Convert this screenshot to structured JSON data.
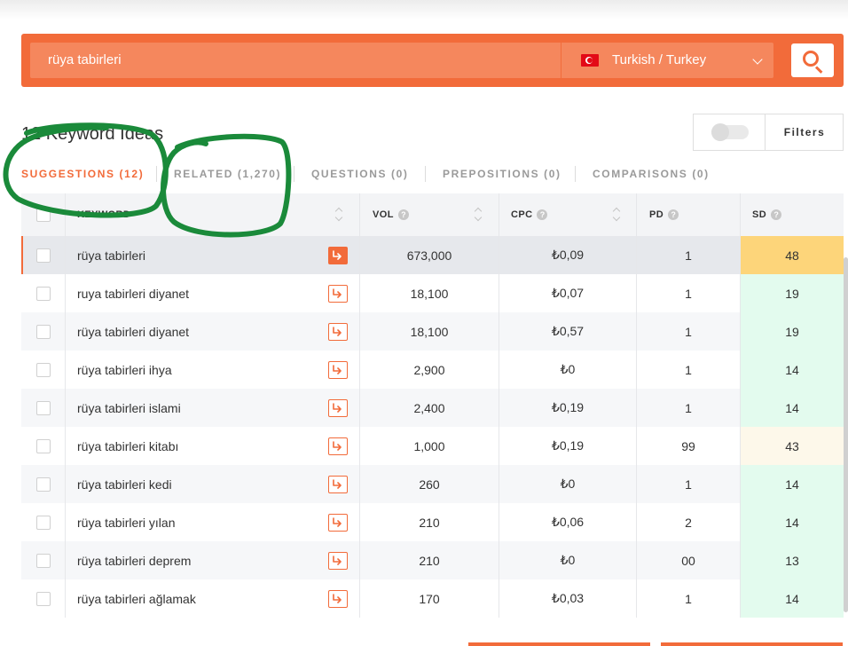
{
  "search": {
    "query": "rüya tabirleri",
    "language": "Turkish / Turkey"
  },
  "ideas_count": "12 Keyword Ideas",
  "filters": {
    "label": "Filters"
  },
  "tabs": [
    {
      "label": "SUGGESTIONS (12)",
      "active": true
    },
    {
      "label": "RELATED (1,270)",
      "active": false
    },
    {
      "label": "QUESTIONS (0)",
      "active": false
    },
    {
      "label": "PREPOSITIONS (0)",
      "active": false
    },
    {
      "label": "COMPARISONS (0)",
      "active": false
    }
  ],
  "table": {
    "headers": {
      "keyword": "KEYWORD",
      "vol": "VOL",
      "cpc": "CPC",
      "pd": "PD",
      "sd": "SD"
    },
    "rows": [
      {
        "keyword": "rüya tabirleri",
        "vol": "673,000",
        "cpc": "₺0,09",
        "pd": "1",
        "sd": "48",
        "sd_color": "#fdd57a"
      },
      {
        "keyword": "ruya tabirleri diyanet",
        "vol": "18,100",
        "cpc": "₺0,07",
        "pd": "1",
        "sd": "19",
        "sd_color": "#e3fbee"
      },
      {
        "keyword": "rüya tabirleri diyanet",
        "vol": "18,100",
        "cpc": "₺0,57",
        "pd": "1",
        "sd": "19",
        "sd_color": "#e3fbee"
      },
      {
        "keyword": "rüya tabirleri ihya",
        "vol": "2,900",
        "cpc": "₺0",
        "pd": "1",
        "sd": "14",
        "sd_color": "#e3fbee"
      },
      {
        "keyword": "rüya tabirleri islami",
        "vol": "2,400",
        "cpc": "₺0,19",
        "pd": "1",
        "sd": "14",
        "sd_color": "#e3fbee"
      },
      {
        "keyword": "rüya tabirleri kitabı",
        "vol": "1,000",
        "cpc": "₺0,19",
        "pd": "99",
        "sd": "43",
        "sd_color": "#fdf8ea"
      },
      {
        "keyword": "rüya tabirleri kedi",
        "vol": "260",
        "cpc": "₺0",
        "pd": "1",
        "sd": "14",
        "sd_color": "#e3fbee"
      },
      {
        "keyword": "rüya tabirleri yılan",
        "vol": "210",
        "cpc": "₺0,06",
        "pd": "2",
        "sd": "14",
        "sd_color": "#e3fbee"
      },
      {
        "keyword": "rüya tabirleri deprem",
        "vol": "210",
        "cpc": "₺0",
        "pd": "00",
        "sd": "13",
        "sd_color": "#e3fbee"
      },
      {
        "keyword": "rüya tabirleri ağlamak",
        "vol": "170",
        "cpc": "₺0,03",
        "pd": "1",
        "sd": "14",
        "sd_color": "#e3fbee"
      }
    ]
  },
  "colors": {
    "accent": "#f26b3a",
    "annotation": "#1a8a3a"
  }
}
